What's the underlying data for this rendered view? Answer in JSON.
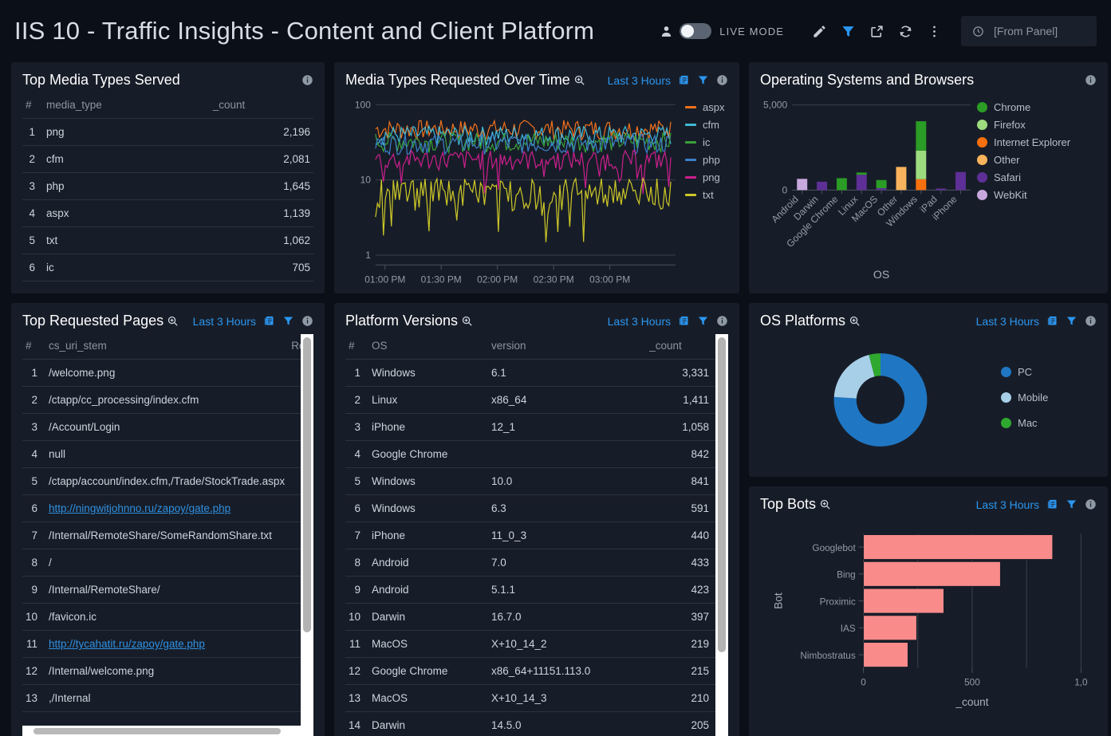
{
  "header": {
    "title": "IIS 10 - Traffic Insights - Content and Client Platform",
    "live_mode_label": "LIVE MODE",
    "icons": {
      "user": "user-icon",
      "edit": "pencil-icon",
      "filter": "filter-icon",
      "share": "share-icon",
      "refresh": "refresh-icon",
      "more": "more-vertical-icon",
      "clock": "clock-icon"
    },
    "timepicker_value": "[From Panel]"
  },
  "common": {
    "time_range_label": "Last 3 Hours",
    "search_icon": "search-zoom-icon",
    "data_icon": "data-source-icon",
    "filter_icon": "filter-icon",
    "info_icon": "info-icon"
  },
  "panels": {
    "top_media_types": {
      "title": "Top Media Types Served",
      "columns": [
        "#",
        "media_type",
        "_count"
      ],
      "rows": [
        [
          "1",
          "png",
          "2,196"
        ],
        [
          "2",
          "cfm",
          "2,081"
        ],
        [
          "3",
          "php",
          "1,645"
        ],
        [
          "4",
          "aspx",
          "1,139"
        ],
        [
          "5",
          "txt",
          "1,062"
        ],
        [
          "6",
          "ic",
          "705"
        ]
      ]
    },
    "media_over_time": {
      "title": "Media Types Requested Over Time"
    },
    "os_browsers": {
      "title": "Operating Systems and Browsers"
    },
    "top_pages": {
      "title": "Top Requested Pages",
      "columns": [
        "#",
        "cs_uri_stem",
        "Req"
      ],
      "rows": [
        {
          "i": "1",
          "uri": "/welcome.png",
          "link": false
        },
        {
          "i": "2",
          "uri": "/ctapp/cc_processing/index.cfm",
          "link": false
        },
        {
          "i": "3",
          "uri": "/Account/Login",
          "link": false
        },
        {
          "i": "4",
          "uri": "null",
          "link": false
        },
        {
          "i": "5",
          "uri": "/ctapp/account/index.cfm,/Trade/StockTrade.aspx",
          "link": false
        },
        {
          "i": "6",
          "uri": "http://ningwitjohnno.ru/zapoy/gate.php",
          "link": true
        },
        {
          "i": "7",
          "uri": "/Internal/RemoteShare/SomeRandomShare.txt",
          "link": false
        },
        {
          "i": "8",
          "uri": "/",
          "link": false
        },
        {
          "i": "9",
          "uri": "/Internal/RemoteShare/",
          "link": false
        },
        {
          "i": "10",
          "uri": "/favicon.ic",
          "link": false
        },
        {
          "i": "11",
          "uri": "http://tycahatit.ru/zapoy/gate.php",
          "link": true
        },
        {
          "i": "12",
          "uri": "/Internal/welcome.png",
          "link": false
        },
        {
          "i": "13",
          "uri": ",/Internal",
          "link": false
        }
      ]
    },
    "platform_versions": {
      "title": "Platform Versions",
      "columns": [
        "#",
        "OS",
        "version",
        "_count"
      ],
      "rows": [
        [
          "1",
          "Windows",
          "6.1",
          "3,331"
        ],
        [
          "2",
          "Linux",
          "x86_64",
          "1,411"
        ],
        [
          "3",
          "iPhone",
          "12_1",
          "1,058"
        ],
        [
          "4",
          "Google Chrome",
          "",
          "842"
        ],
        [
          "5",
          "Windows",
          "10.0",
          "841"
        ],
        [
          "6",
          "Windows",
          "6.3",
          "591"
        ],
        [
          "7",
          "iPhone",
          "11_0_3",
          "440"
        ],
        [
          "8",
          "Android",
          "7.0",
          "433"
        ],
        [
          "9",
          "Android",
          "5.1.1",
          "423"
        ],
        [
          "10",
          "Darwin",
          "16.7.0",
          "397"
        ],
        [
          "11",
          "MacOS",
          "X+10_14_2",
          "219"
        ],
        [
          "12",
          "Google Chrome",
          "x86_64+11151.113.0",
          "215"
        ],
        [
          "13",
          "MacOS",
          "X+10_14_3",
          "210"
        ],
        [
          "14",
          "Darwin",
          "14.5.0",
          "205"
        ]
      ]
    },
    "os_platforms": {
      "title": "OS Platforms"
    },
    "top_bots": {
      "title": "Top Bots"
    }
  },
  "chart_data": [
    {
      "id": "media_over_time",
      "type": "line",
      "title": "Media Types Requested Over Time",
      "xlabel": "",
      "ylabel": "",
      "yscale": "log",
      "ylim": [
        1,
        100
      ],
      "yticks": [
        "1",
        "10",
        "100"
      ],
      "xticks": [
        "01:00 PM",
        "01:30 PM",
        "02:00 PM",
        "02:30 PM",
        "03:00 PM"
      ],
      "legend_position": "right",
      "series": [
        {
          "name": "aspx",
          "color": "#f2711c",
          "mean": 48
        },
        {
          "name": "cfm",
          "color": "#3fb9d6",
          "mean": 40
        },
        {
          "name": "ic",
          "color": "#3aa03a",
          "mean": 33
        },
        {
          "name": "php",
          "color": "#3b80c9",
          "mean": 31
        },
        {
          "name": "png",
          "color": "#cc1f8e",
          "mean": 19
        },
        {
          "name": "txt",
          "color": "#cfc927",
          "mean": 7
        }
      ]
    },
    {
      "id": "os_browsers",
      "type": "bar",
      "subtype": "stacked",
      "title": "Operating Systems and Browsers",
      "xlabel": "OS",
      "ylabel": "",
      "ylim": [
        0,
        5000
      ],
      "yticks": [
        "0",
        "5,000"
      ],
      "categories": [
        "Android",
        "Darwin",
        "Google Chrome",
        "Linux",
        "MacOS",
        "Other",
        "Windows",
        "iPad",
        "iPhone"
      ],
      "legend_position": "right",
      "series": [
        {
          "name": "Chrome",
          "color": "#2b9c25",
          "values": [
            0,
            0,
            700,
            130,
            480,
            0,
            1720,
            0,
            0
          ]
        },
        {
          "name": "Firefox",
          "color": "#9ddb7f",
          "values": [
            0,
            0,
            0,
            0,
            0,
            0,
            1680,
            0,
            0
          ]
        },
        {
          "name": "Internet Explorer",
          "color": "#f7700d",
          "values": [
            0,
            0,
            0,
            0,
            0,
            0,
            640,
            0,
            0
          ]
        },
        {
          "name": "Other",
          "color": "#f9b35c",
          "values": [
            0,
            0,
            0,
            0,
            0,
            1360,
            0,
            0,
            0
          ]
        },
        {
          "name": "Safari",
          "color": "#5e2f96",
          "values": [
            0,
            490,
            0,
            900,
            110,
            0,
            0,
            90,
            1060
          ]
        },
        {
          "name": "WebKit",
          "color": "#c8a9de",
          "values": [
            660,
            0,
            0,
            0,
            0,
            0,
            0,
            0,
            0
          ]
        }
      ]
    },
    {
      "id": "os_platforms",
      "type": "pie",
      "subtype": "donut",
      "title": "OS Platforms",
      "legend_position": "right",
      "labels": [
        "PC",
        "Mobile",
        "Mac"
      ],
      "values": [
        76,
        20,
        4
      ],
      "colors": [
        "#1f77c4",
        "#a8cfe8",
        "#2fa82f"
      ]
    },
    {
      "id": "top_bots",
      "type": "bar",
      "subtype": "horizontal",
      "title": "Top Bots",
      "xlabel": "_count",
      "ylabel": "Bot",
      "xlim": [
        0,
        1000
      ],
      "xticks": [
        "0",
        "500",
        "1,0"
      ],
      "categories": [
        "Googlebot",
        "Bing",
        "Proximic",
        "IAS",
        "Nimbostratus"
      ],
      "values": [
        870,
        630,
        370,
        245,
        205
      ],
      "color": "#f98b8b"
    }
  ]
}
